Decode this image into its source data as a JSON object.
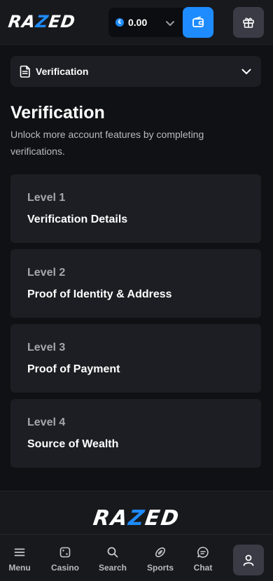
{
  "header": {
    "logo": {
      "pre": "RA",
      "accent": "Z",
      "post": "ED"
    },
    "balance": {
      "currency_symbol": "€",
      "amount": "0.00"
    },
    "icons": [
      "chevron-down-icon",
      "wallet-icon",
      "gift-icon"
    ]
  },
  "dropdown": {
    "label": "Verification",
    "icon": "document-icon"
  },
  "page": {
    "title": "Verification",
    "subtitle": "Unlock more account features by completing verifications."
  },
  "levels": [
    {
      "level": "Level 1",
      "name": "Verification Details"
    },
    {
      "level": "Level 2",
      "name": "Proof of Identity & Address"
    },
    {
      "level": "Level 3",
      "name": "Proof of Payment"
    },
    {
      "level": "Level 4",
      "name": "Source of Wealth"
    }
  ],
  "footer": {
    "logo": {
      "pre": "RA",
      "accent": "Z",
      "post": "ED"
    }
  },
  "bottom_nav": [
    {
      "label": "Menu",
      "icon": "menu-icon"
    },
    {
      "label": "Casino",
      "icon": "dice-icon"
    },
    {
      "label": "Search",
      "icon": "search-icon"
    },
    {
      "label": "Sports",
      "icon": "football-icon"
    },
    {
      "label": "Chat",
      "icon": "chat-icon"
    },
    {
      "label": "",
      "icon": "user-icon"
    }
  ],
  "colors": {
    "accent": "#1e8cff",
    "background": "#101114",
    "card": "#1d1e23",
    "muted_text": "#a6a7ad"
  }
}
